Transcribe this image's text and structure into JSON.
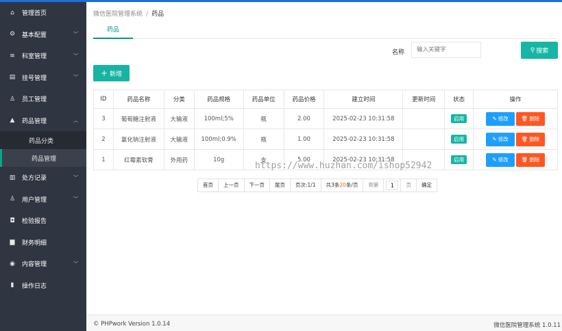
{
  "sidebar": {
    "items": [
      {
        "label": "管理首页",
        "icon": "home-icon",
        "glyph": "⌂",
        "chev": ""
      },
      {
        "label": "基本配置",
        "icon": "gear-icon",
        "glyph": "⚙",
        "chev": "﹀"
      },
      {
        "label": "科室管理",
        "icon": "layers-icon",
        "glyph": "≋",
        "chev": "﹀"
      },
      {
        "label": "挂号管理",
        "icon": "clipboard-icon",
        "glyph": "▤",
        "chev": "﹀"
      },
      {
        "label": "员工管理",
        "icon": "user-icon",
        "glyph": "♙",
        "chev": ""
      },
      {
        "label": "药品管理",
        "icon": "bottle-icon",
        "glyph": "▲",
        "chev": "︿"
      }
    ],
    "sub_items": [
      {
        "label": "药品分类"
      },
      {
        "label": "药品管理"
      }
    ],
    "items_after": [
      {
        "label": "处方记录",
        "icon": "document-icon",
        "glyph": "▥",
        "chev": "﹀"
      },
      {
        "label": "用户管理",
        "icon": "user-icon",
        "glyph": "♙",
        "chev": "﹀"
      },
      {
        "label": "检验报告",
        "icon": "report-icon",
        "glyph": "◘",
        "chev": ""
      },
      {
        "label": "财务明细",
        "icon": "money-icon",
        "glyph": "▆",
        "chev": ""
      },
      {
        "label": "内容管理",
        "icon": "globe-icon",
        "glyph": "◉",
        "chev": "﹀"
      },
      {
        "label": "操作日志",
        "icon": "log-icon",
        "glyph": "▮",
        "chev": ""
      }
    ]
  },
  "breadcrumb": {
    "parent": "微信医院管理系统",
    "separator": "/",
    "current": "药品"
  },
  "tab": {
    "label": "药品"
  },
  "search": {
    "label": "名称",
    "placeholder": "输入关键字",
    "button": "搜索",
    "button_icon": "⚲"
  },
  "add_button": {
    "label": "新增",
    "icon": "+"
  },
  "table": {
    "headers": [
      "ID",
      "药品名称",
      "分类",
      "药品规格",
      "药品单位",
      "药品价格",
      "建立时间",
      "更新时间",
      "状态",
      "操作"
    ],
    "rows": [
      {
        "id": "3",
        "name": "葡萄糖注射液",
        "category": "大输液",
        "spec": "100ml;5%",
        "unit": "瓶",
        "price": "2.00",
        "created": "2025-02-23 10:31:58",
        "updated": "",
        "status": "启用",
        "edit": "修改",
        "delete": "删除"
      },
      {
        "id": "2",
        "name": "氯化钠注射液",
        "category": "大输液",
        "spec": "100ml;0.9%",
        "unit": "瓶",
        "price": "1.00",
        "created": "2025-02-23 10:31:58",
        "updated": "",
        "status": "启用",
        "edit": "修改",
        "delete": "删除"
      },
      {
        "id": "1",
        "name": "红霉素软膏",
        "category": "外用药",
        "spec": "10g",
        "unit": "支",
        "price": "5.00",
        "created": "2025-02-23 10:31:58",
        "updated": "",
        "status": "启用",
        "edit": "修改",
        "delete": "删除"
      }
    ]
  },
  "pager": {
    "first": "首页",
    "prev": "上一页",
    "next": "下一页",
    "last": "尾页",
    "page_info": "页次:1/1",
    "total_prefix": "共3条",
    "per_page": "20",
    "per_page_suffix": "条/页",
    "goto": "到第",
    "goto_value": "1",
    "page_unit": "页",
    "confirm": "确定"
  },
  "watermark": "https://www.huzhan.com/ishop52942",
  "footer": {
    "left": "© PHPwork Version 1.0.14",
    "right": "微信医院管理系统 1.0.11"
  },
  "colors": {
    "sidebar": "#2f3541",
    "accent": "#009688",
    "edit": "#1e9fff",
    "delete": "#ff5722",
    "topbar": "#1e6fd9"
  }
}
